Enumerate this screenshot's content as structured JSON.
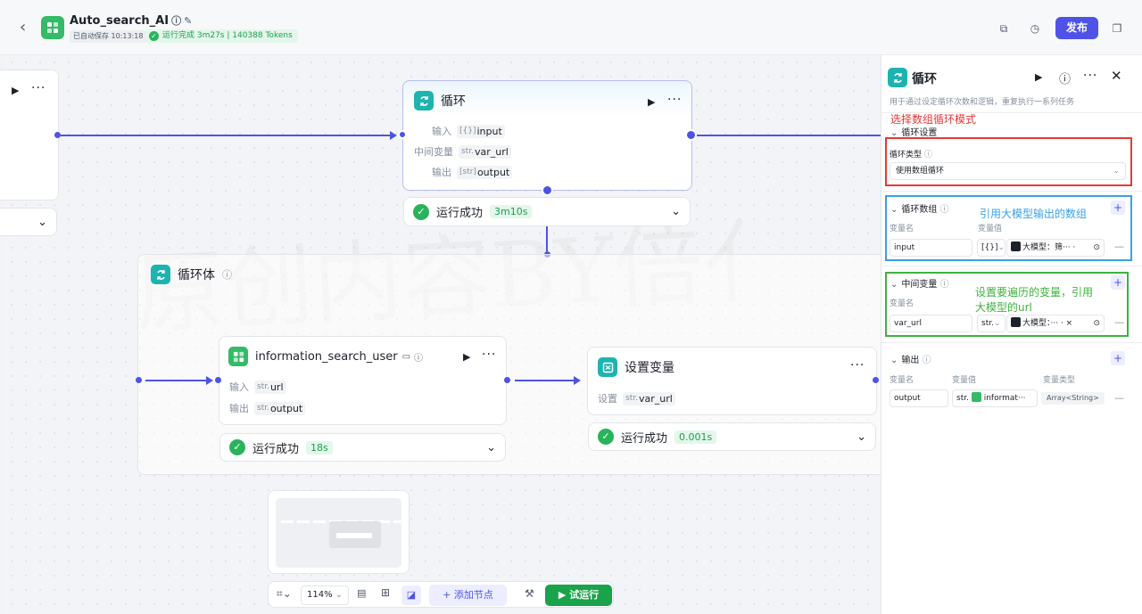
{
  "header": {
    "app_title": "Auto_search_AI",
    "autosave": "已自动保存 10:13:18",
    "run_status": "运行完成 3m27s | 140388 Tokens",
    "publish_label": "发布"
  },
  "canvas": {
    "watermark": "原创内容BY倍亻",
    "loop_node": {
      "title": "循环",
      "rows": [
        {
          "label": "输入",
          "prefix": "[{}]",
          "value": "input"
        },
        {
          "label": "中间变量",
          "prefix": "str.",
          "value": "var_url"
        },
        {
          "label": "输出",
          "prefix": "[str]",
          "value": "output"
        }
      ],
      "status": "运行成功",
      "time": "3m10s"
    },
    "loop_body": {
      "title": "循环体"
    },
    "search_node": {
      "title": "information_search_user",
      "rows": [
        {
          "label": "输入",
          "prefix": "str.",
          "value": "url"
        },
        {
          "label": "输出",
          "prefix": "str.",
          "value": "output"
        }
      ],
      "status": "运行成功",
      "time": "18s"
    },
    "setvar_node": {
      "title": "设置变量",
      "rows": [
        {
          "label": "设置",
          "prefix": "str.",
          "value": "var_url"
        }
      ],
      "status": "运行成功",
      "time": "0.001s"
    }
  },
  "toolbar": {
    "zoom": "114%",
    "add_node": "添加节点",
    "test_run": "试运行"
  },
  "panel": {
    "title": "循环",
    "description": "用于通过设定循环次数和逻辑，重复执行一系列任务",
    "loop_settings": {
      "title": "循环设置",
      "type_label": "循环类型",
      "type_value": "使用数组循环"
    },
    "loop_array": {
      "title": "循环数组",
      "col_name": "变量名",
      "col_value": "变量值",
      "var_name": "input",
      "type_prefix": "[{}]",
      "ref": "大模型：筛··· ·"
    },
    "intermediate": {
      "title": "中间变量",
      "col_name": "变量名",
      "var_name": "var_url",
      "type_prefix": "str.",
      "ref": "大模型：··· · ×"
    },
    "output": {
      "title": "输出",
      "col_name": "变量名",
      "col_value": "变量值",
      "col_type": "变量类型",
      "var_name": "output",
      "type_prefix": "str.",
      "ref": "informat···",
      "var_type": "Array<String>"
    }
  },
  "annotations": {
    "red": "选择数组循环模式",
    "blue": "引用大模型输出的数组",
    "green_line1": "设置要遍历的变量，引用",
    "green_line2": "大模型的url"
  },
  "colors": {
    "accent": "#4e53e6",
    "success": "#29b35c",
    "teal": "#1fb3b0",
    "annotation_red": "#e53935",
    "annotation_blue": "#3aa0e8",
    "annotation_green": "#3fb23f"
  }
}
